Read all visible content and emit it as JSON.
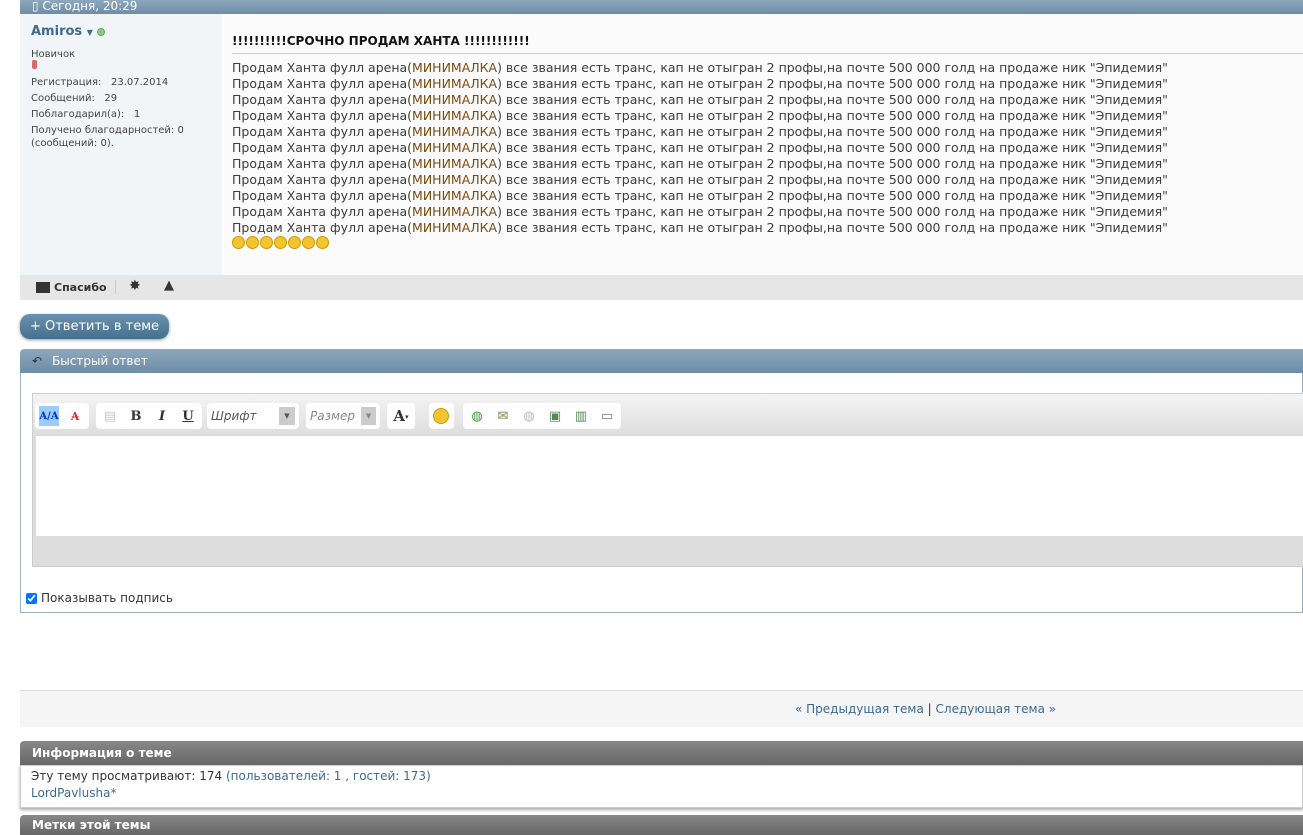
{
  "post": {
    "date": "Сегодня, 20:29",
    "title": "!!!!!!!!!!СРОЧНО ПРОДАМ ХАНТА !!!!!!!!!!!!",
    "line_a": "Продам Ханта фулл арена(",
    "line_hl": "МИНИМАЛКА",
    "line_b": ") все звания есть транс, кап не отыгран 2 профы,на почте 500 000 голд на продаже ник \"Эпидемия\"",
    "line_count": 11,
    "smiley_count": 7
  },
  "user": {
    "name": "Amiros",
    "rank": "Новичок",
    "reg_label": "Регистрация:",
    "reg": "23.07.2014",
    "posts_label": "Сообщений:",
    "posts": "29",
    "thanked_label": "Поблагодарил(а):",
    "thanked": "1",
    "received": "Получено благодарностей: 0",
    "received2": "(сообщений: 0)."
  },
  "footer": {
    "thanks": "Спасибо"
  },
  "reply_button": "+ Ответить в теме",
  "quick_reply": {
    "title": "Быстрый ответ",
    "font": "Шрифт",
    "size": "Размер",
    "show_signature": "Показывать подпись"
  },
  "nav": {
    "prev": "« Предыдущая тема",
    "sep": "|",
    "next": "Следующая тема »"
  },
  "info": {
    "title": "Информация о теме",
    "viewing_label": "Эту тему просматривают:",
    "viewing": "174",
    "detail": "(пользователей: 1 , гостей: 173)",
    "user": "LordPavlusha*",
    "tags_title": "Метки этой темы"
  }
}
